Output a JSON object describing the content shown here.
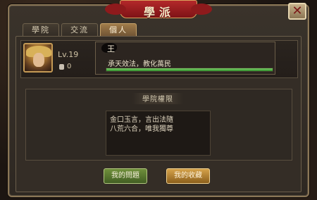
{
  "window": {
    "title": "學派",
    "close_symbol": "✕"
  },
  "tabs": [
    {
      "label": "學院",
      "active": false
    },
    {
      "label": "交流",
      "active": false
    },
    {
      "label": "個人",
      "active": true
    }
  ],
  "profile": {
    "avatar": "character-portrait",
    "level": "Lv.19",
    "coins": "0",
    "name": "王",
    "motto": "承天效法，教化萬民",
    "progress": 1.0
  },
  "privileges": {
    "title": "學院權限",
    "lines": [
      "金口玉言，言出法隨",
      "八荒六合，唯我獨尊"
    ]
  },
  "buttons": {
    "my_questions": "我的問題",
    "my_collection": "我的收藏"
  },
  "colors": {
    "accent_green": "#2e8a2a",
    "banner_red": "#b3282a",
    "gold_button": "#d5a24a"
  }
}
